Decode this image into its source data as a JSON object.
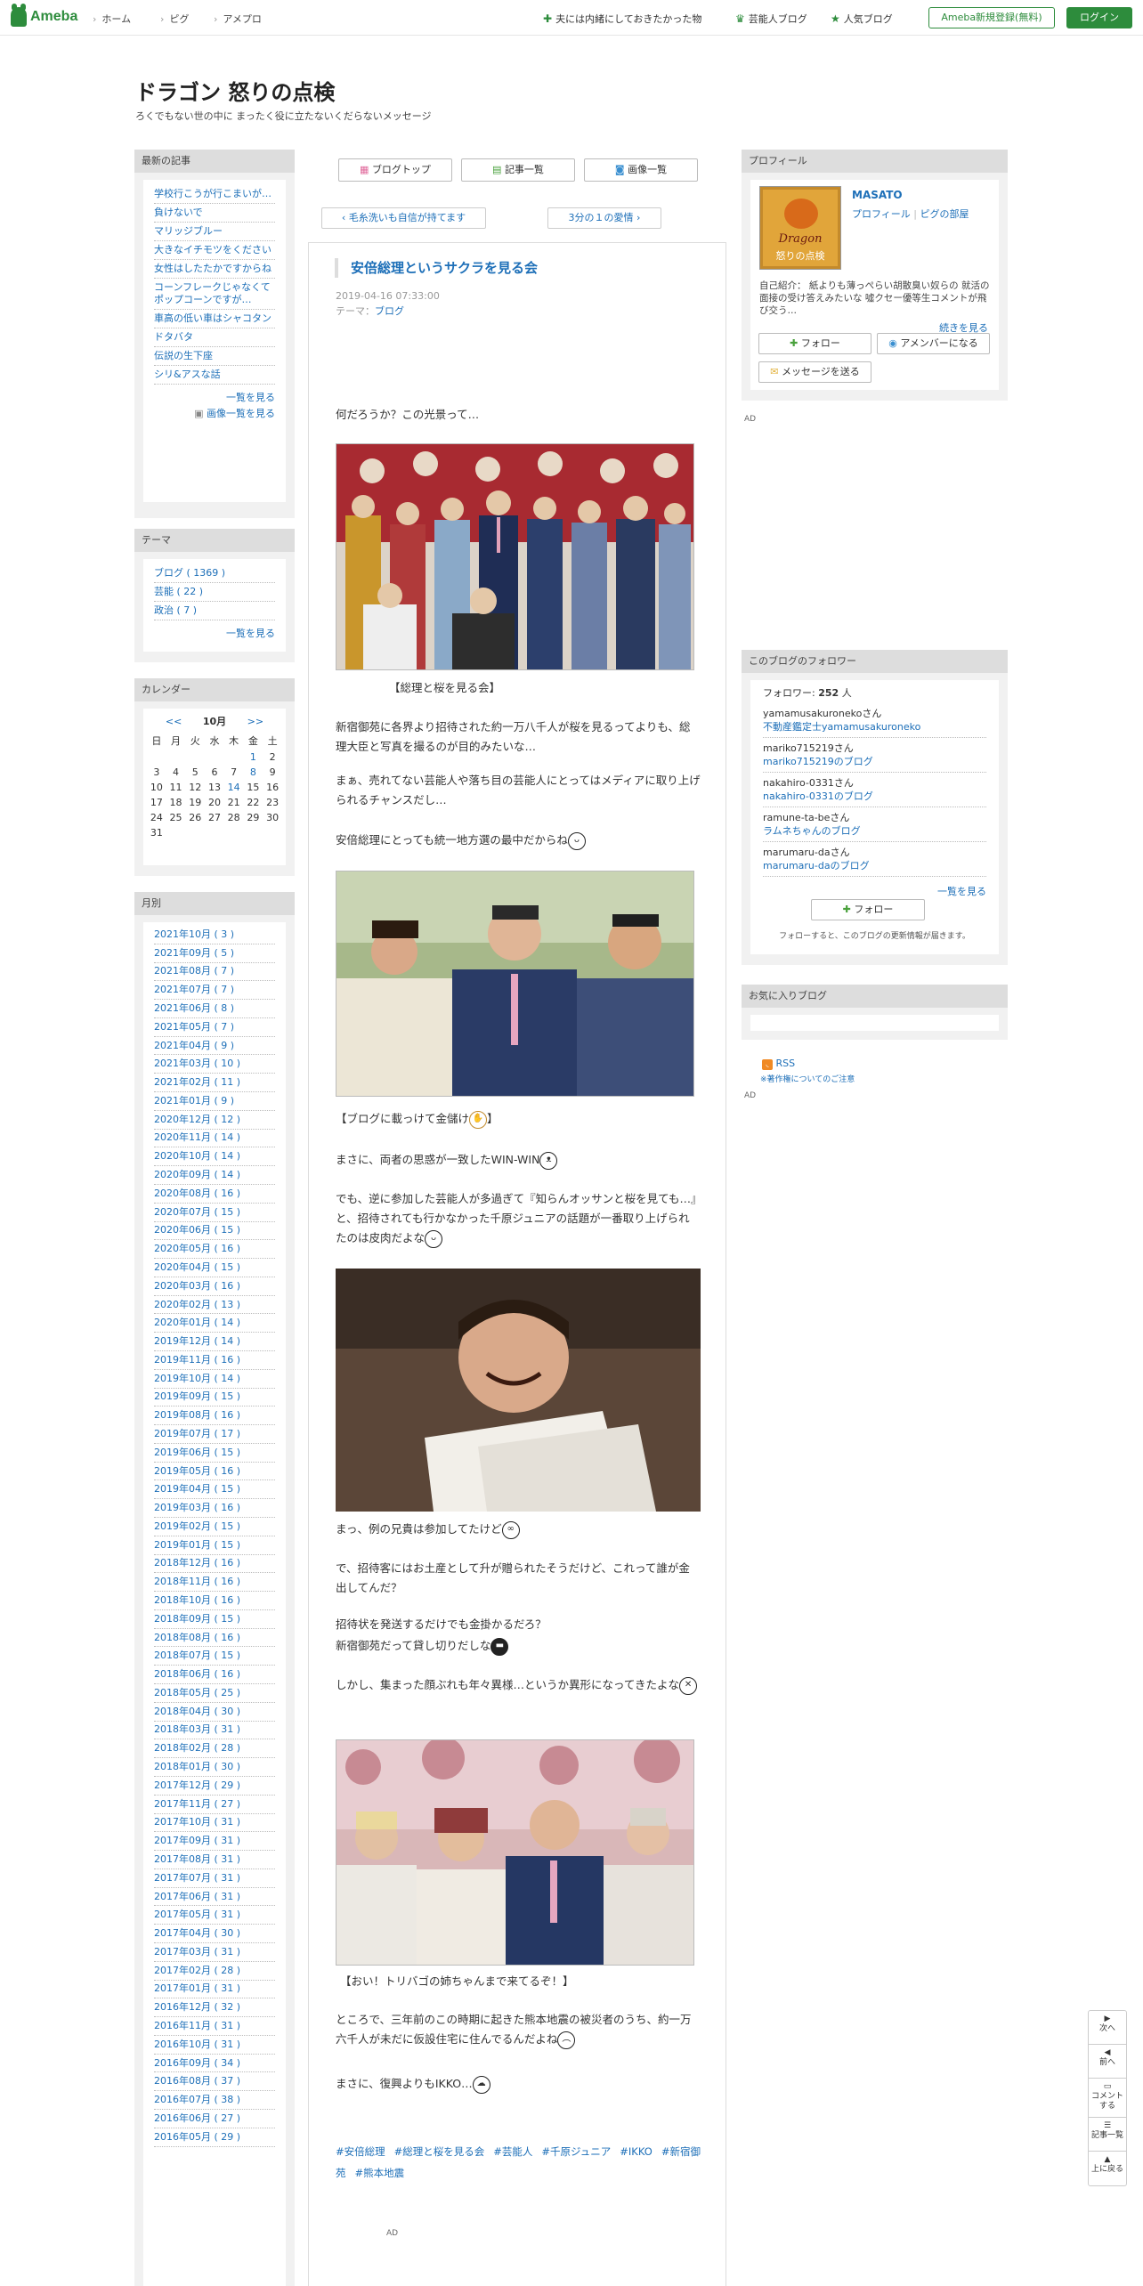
{
  "topbar": {
    "logo": "Ameba",
    "nav": [
      "ホーム",
      "ピグ",
      "アメプロ"
    ],
    "right_links": [
      "夫には内緒にしておきたかった物",
      "芸能人ブログ",
      "人気ブログ"
    ],
    "register": "Ameba新規登録(無料)",
    "login": "ログイン"
  },
  "header": {
    "title": "ドラゴン 怒りの点検",
    "description": "ろくでもない世の中に まったく役に立たないくだらないメッセージ"
  },
  "tabs": [
    "ブログトップ",
    "記事一覧",
    "画像一覧"
  ],
  "pager": {
    "prev": "毛糸洗いも自信が持てます",
    "next": "3分の１の愛情"
  },
  "entry": {
    "title": "安倍総理というサクラを見る会",
    "date": "2019-04-16 07:33:00",
    "theme_label": "テーマ：",
    "theme": "ブログ",
    "p1": "何だろうか？この光景って…",
    "caption1": "【総理と桜を見る会】",
    "p2": "新宿御苑に各界より招待された約一万八千人が桜を見るってよりも、総理大臣と写真を撮るのが目的みたいな…",
    "p3": "まぁ、売れてない芸能人や落ち目の芸能人にとってはメディアに取り上げられるチャンスだし…",
    "p4": "安倍総理にとっても統一地方選の最中だからね",
    "caption2": "【ブログに載っけて金儲け",
    "caption2_end": "】",
    "p5": "まさに、両者の思惑が一致したWIN-WIN",
    "p6": "でも、逆に参加した芸能人が多過ぎて『知らんオッサンと桜を見ても…』と、招待されても行かなかった千原ジュニアの話題が一番取り上げられたのは皮肉だよな",
    "p7": "まっ、例の兄貴は参加してたけど",
    "p8": "で、招待客にはお土産として升が贈られたそうだけど、これって誰が金出してんだ？",
    "p9a": "招待状を発送するだけでも金掛かるだろ？",
    "p9b": "新宿御苑だって貸し切りだしな",
    "p10": "しかし、集まった顔ぶれも年々異様…というか異形になってきたよな",
    "caption3": "【おい！トリバゴの姉ちゃんまで来てるぞ！】",
    "p11": "ところで、三年前のこの時期に起きた熊本地震の被災者のうち、約一万六千人が未だに仮設住宅に住んでるんだよね",
    "p12": "まさに、復興よりもIKKO…",
    "tags": [
      "#安倍総理",
      "#総理と桜を見る会",
      "#芸能人",
      "#千原ジュニア",
      "#IKKO",
      "#新宿御苑",
      "#熊本地震"
    ],
    "ad": "AD"
  },
  "recent": {
    "title": "最新の記事",
    "items": [
      "学校行こうが行こまいが…",
      "負けないで",
      "マリッジブルー",
      "大きなイチモツをください",
      "女性はしたたかですからね",
      "コーンフレークじゃなくてポップコーンですが…",
      "車高の低い車はシャコタン",
      "ドタバタ",
      "伝説の生下座",
      "シリ&アスな話"
    ],
    "more": "一覧を見る",
    "images": "画像一覧を見る"
  },
  "theme": {
    "title": "テーマ",
    "items": [
      "ブログ ( 1369 )",
      "芸能 ( 22 )",
      "政治 ( 7 )"
    ],
    "more": "一覧を見る"
  },
  "calendar": {
    "title": "カレンダー",
    "prev": "<<",
    "month": "10月",
    "next": ">>",
    "weekdays": [
      "日",
      "月",
      "火",
      "水",
      "木",
      "金",
      "土"
    ],
    "weeks": [
      [
        "",
        "",
        "",
        "",
        "",
        "1",
        "2"
      ],
      [
        "3",
        "4",
        "5",
        "6",
        "7",
        "8",
        "9"
      ],
      [
        "10",
        "11",
        "12",
        "13",
        "14",
        "15",
        "16"
      ],
      [
        "17",
        "18",
        "19",
        "20",
        "21",
        "22",
        "23"
      ],
      [
        "24",
        "25",
        "26",
        "27",
        "28",
        "29",
        "30"
      ],
      [
        "31",
        "",
        "",
        "",
        "",
        "",
        ""
      ]
    ],
    "linked_days": [
      "1",
      "8",
      "14"
    ]
  },
  "archive": {
    "title": "月別",
    "items": [
      "2021年10月 ( 3 )",
      "2021年09月 ( 5 )",
      "2021年08月 ( 7 )",
      "2021年07月 ( 7 )",
      "2021年06月 ( 8 )",
      "2021年05月 ( 7 )",
      "2021年04月 ( 9 )",
      "2021年03月 ( 10 )",
      "2021年02月 ( 11 )",
      "2021年01月 ( 9 )",
      "2020年12月 ( 12 )",
      "2020年11月 ( 14 )",
      "2020年10月 ( 14 )",
      "2020年09月 ( 14 )",
      "2020年08月 ( 16 )",
      "2020年07月 ( 15 )",
      "2020年06月 ( 15 )",
      "2020年05月 ( 16 )",
      "2020年04月 ( 15 )",
      "2020年03月 ( 16 )",
      "2020年02月 ( 13 )",
      "2020年01月 ( 14 )",
      "2019年12月 ( 14 )",
      "2019年11月 ( 16 )",
      "2019年10月 ( 14 )",
      "2019年09月 ( 15 )",
      "2019年08月 ( 16 )",
      "2019年07月 ( 17 )",
      "2019年06月 ( 15 )",
      "2019年05月 ( 16 )",
      "2019年04月 ( 15 )",
      "2019年03月 ( 16 )",
      "2019年02月 ( 15 )",
      "2019年01月 ( 15 )",
      "2018年12月 ( 16 )",
      "2018年11月 ( 16 )",
      "2018年10月 ( 16 )",
      "2018年09月 ( 15 )",
      "2018年08月 ( 16 )",
      "2018年07月 ( 15 )",
      "2018年06月 ( 16 )",
      "2018年05月 ( 25 )",
      "2018年04月 ( 30 )",
      "2018年03月 ( 31 )",
      "2018年02月 ( 28 )",
      "2018年01月 ( 30 )",
      "2017年12月 ( 29 )",
      "2017年11月 ( 27 )",
      "2017年10月 ( 31 )",
      "2017年09月 ( 31 )",
      "2017年08月 ( 31 )",
      "2017年07月 ( 31 )",
      "2017年06月 ( 31 )",
      "2017年05月 ( 31 )",
      "2017年04月 ( 30 )",
      "2017年03月 ( 31 )",
      "2017年02月 ( 28 )",
      "2017年01月 ( 31 )",
      "2016年12月 ( 32 )",
      "2016年11月 ( 31 )",
      "2016年10月 ( 31 )",
      "2016年09月 ( 34 )",
      "2016年08月 ( 37 )",
      "2016年07月 ( 38 )",
      "2016年06月 ( 27 )",
      "2016年05月 ( 29 )"
    ]
  },
  "profile": {
    "title": "プロフィール",
    "name": "MASATO",
    "links": [
      "プロフィール",
      "ピグの部屋"
    ],
    "avatar_text": [
      "Dragon",
      "怒りの点検"
    ],
    "intro": "自己紹介： 紙よりも薄っぺらい胡散臭い奴らの 就活の面接の受け答えみたいな 噓クセー優等生コメントが飛び交う…",
    "more": "続きを見る",
    "follow": "フォロー",
    "member": "アメンバーになる",
    "message": "メッセージを送る"
  },
  "ad_label": "AD",
  "followers": {
    "title": "このブログのフォロワー",
    "count_label": "フォロワー:",
    "count": "252",
    "count_unit": "人",
    "items": [
      {
        "id": "yamamusakuronekoさん",
        "blog": "不動産鑑定士yamamusakuroneko"
      },
      {
        "id": "mariko715219さん",
        "blog": "mariko715219のブログ"
      },
      {
        "id": "nakahiro-0331さん",
        "blog": "nakahiro-0331のブログ"
      },
      {
        "id": "ramune-ta-beさん",
        "blog": "ラムネちゃんのブログ"
      },
      {
        "id": "marumaru-daさん",
        "blog": "marumaru-daのブログ"
      }
    ],
    "more": "一覧を見る",
    "follow": "フォロー",
    "note": "フォローすると、このブログの更新情報が届きます。"
  },
  "favorites": {
    "title": "お気に入りブログ"
  },
  "rss": {
    "label": "RSS",
    "note": "※著作権についてのご注意"
  },
  "floatnav": [
    {
      "icon": "▶",
      "label": "次へ"
    },
    {
      "icon": "◀",
      "label": "前へ"
    },
    {
      "icon": "",
      "label": "コメントする"
    },
    {
      "icon": "",
      "label": "記事一覧"
    },
    {
      "icon": "▲",
      "label": "上に戻る"
    }
  ],
  "colors": {
    "brand": "#2d8c3c",
    "link": "#1d6fb8"
  }
}
